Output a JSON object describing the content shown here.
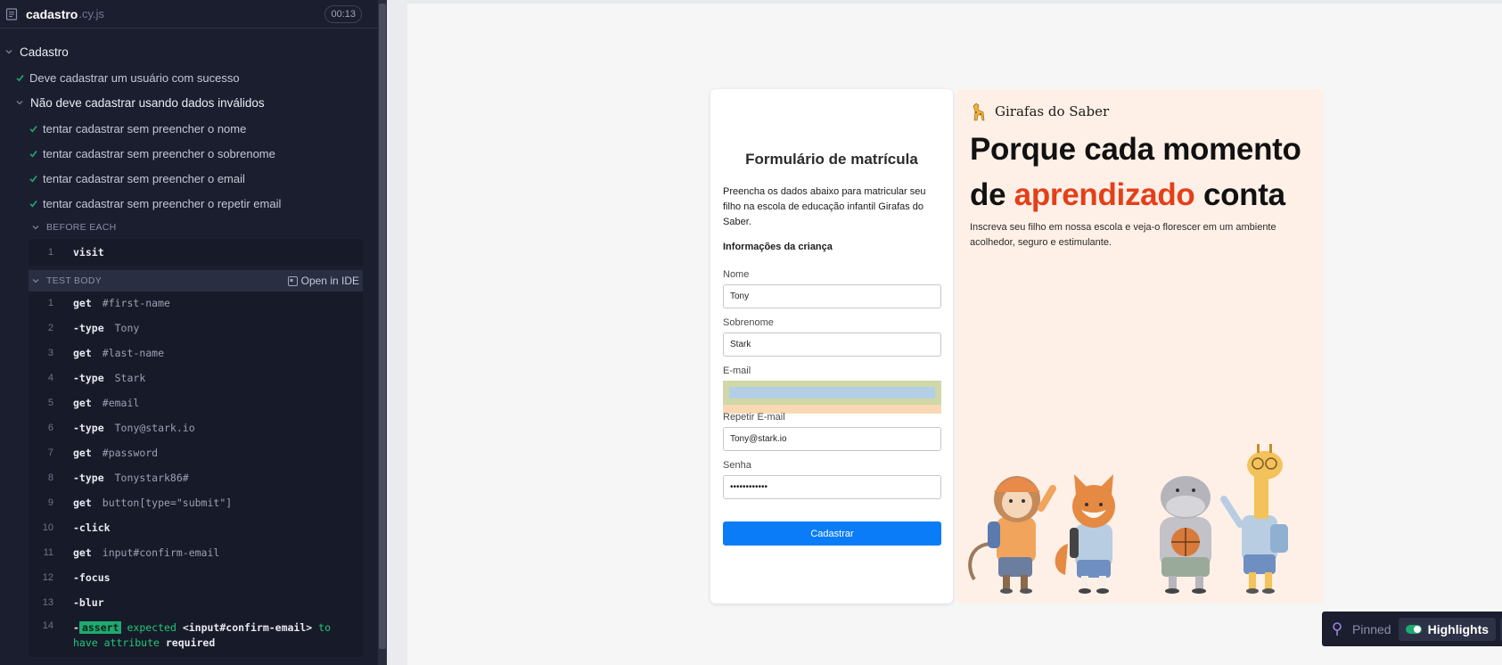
{
  "reporter": {
    "file_name": "cadastro",
    "file_ext": ".cy.js",
    "timer": "00:13",
    "suite": "Cadastro",
    "tests": [
      "Deve cadastrar um usuário com sucesso"
    ],
    "sub_suite": "Não deve cadastrar usando dados inválidos",
    "sub_tests": [
      "tentar cadastrar sem preencher o nome",
      "tentar cadastrar sem preencher o sobrenome",
      "tentar cadastrar sem preencher o email",
      "tentar cadastrar sem preencher o repetir email"
    ],
    "before_each": {
      "label": "BEFORE EACH",
      "commands": [
        {
          "num": "1",
          "name": "visit",
          "msg": ""
        }
      ]
    },
    "test_body": {
      "label": "TEST BODY",
      "open_ide": "Open in IDE",
      "commands": [
        {
          "num": "1",
          "name": "get",
          "msg": "#first-name"
        },
        {
          "num": "2",
          "name": "-type",
          "msg": "Tony"
        },
        {
          "num": "3",
          "name": "get",
          "msg": "#last-name"
        },
        {
          "num": "4",
          "name": "-type",
          "msg": "Stark"
        },
        {
          "num": "5",
          "name": "get",
          "msg": "#email"
        },
        {
          "num": "6",
          "name": "-type",
          "msg": "Tony@stark.io"
        },
        {
          "num": "7",
          "name": "get",
          "msg": "#password"
        },
        {
          "num": "8",
          "name": "-type",
          "msg": "Tonystark86#"
        },
        {
          "num": "9",
          "name": "get",
          "msg": "button[type=\"submit\"]"
        },
        {
          "num": "10",
          "name": "-click",
          "msg": ""
        },
        {
          "num": "11",
          "name": "get",
          "msg": "input#confirm-email"
        },
        {
          "num": "12",
          "name": "-focus",
          "msg": ""
        },
        {
          "num": "13",
          "name": "-blur",
          "msg": ""
        }
      ],
      "assert": {
        "num": "14",
        "prefix": "-",
        "tag": "assert",
        "msg1": "expected",
        "subject": "<input#confirm-email>",
        "msg2": "to have attribute",
        "value": "required"
      }
    }
  },
  "form": {
    "title": "Formulário de matrícula",
    "description": "Preencha os dados abaixo para matricular seu filho na escola de educação infantil Girafas do Saber.",
    "section": "Informações da criança",
    "fields": {
      "first_name": {
        "label": "Nome",
        "value": "Tony"
      },
      "last_name": {
        "label": "Sobrenome",
        "value": "Stark"
      },
      "email": {
        "label": "E-mail",
        "value": ""
      },
      "confirm_email": {
        "label": "Repetir E-mail",
        "value": "Tony@stark.io"
      },
      "password": {
        "label": "Senha",
        "value": "Tonystark86#"
      }
    },
    "submit": "Cadastrar"
  },
  "promo": {
    "brand": "Girafas do Saber",
    "headline_1": "Porque cada momento",
    "headline_2a": "de ",
    "headline_2b": "aprendizado",
    "headline_2c": " conta",
    "subtitle": "Inscreva seu filho em nossa escola e veja-o florescer em um ambiente acolhedor, seguro e estimulante."
  },
  "pinbar": {
    "pinned": "Pinned",
    "highlights": "Highlights"
  },
  "colors": {
    "reporter_bg": "#1b1e2e",
    "pass_green": "#1fa971",
    "accent_orange": "#e3401a",
    "submit_blue": "#0a7cf8",
    "promo_bg": "#fff0e7"
  }
}
